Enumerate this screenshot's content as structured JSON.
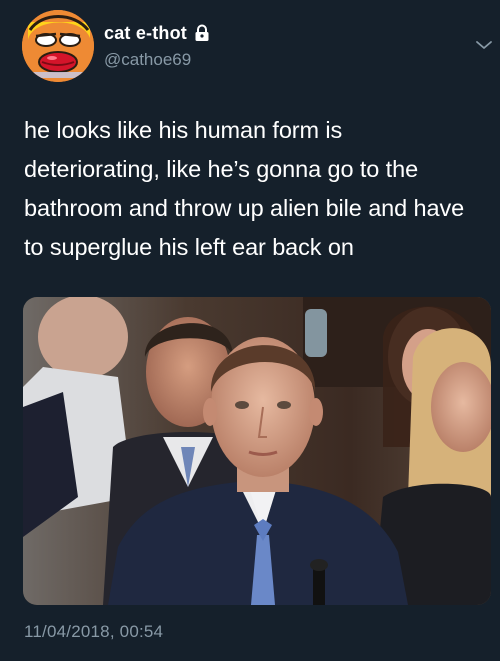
{
  "tweet": {
    "display_name": "cat e-thot",
    "handle": "@cathoe69",
    "text": "he looks like his human form is deteriorating, like he’s gonna go to the bathroom and throw up alien bile and have to superglue his left ear back on",
    "timestamp": "11/04/2018, 00:54",
    "media_alt": "",
    "icons": {
      "protected": "lock-icon",
      "menu": "chevron-down-icon"
    }
  },
  "colors": {
    "background": "#15202b",
    "primary_text": "#ffffff",
    "secondary_text": "#8899a6"
  }
}
